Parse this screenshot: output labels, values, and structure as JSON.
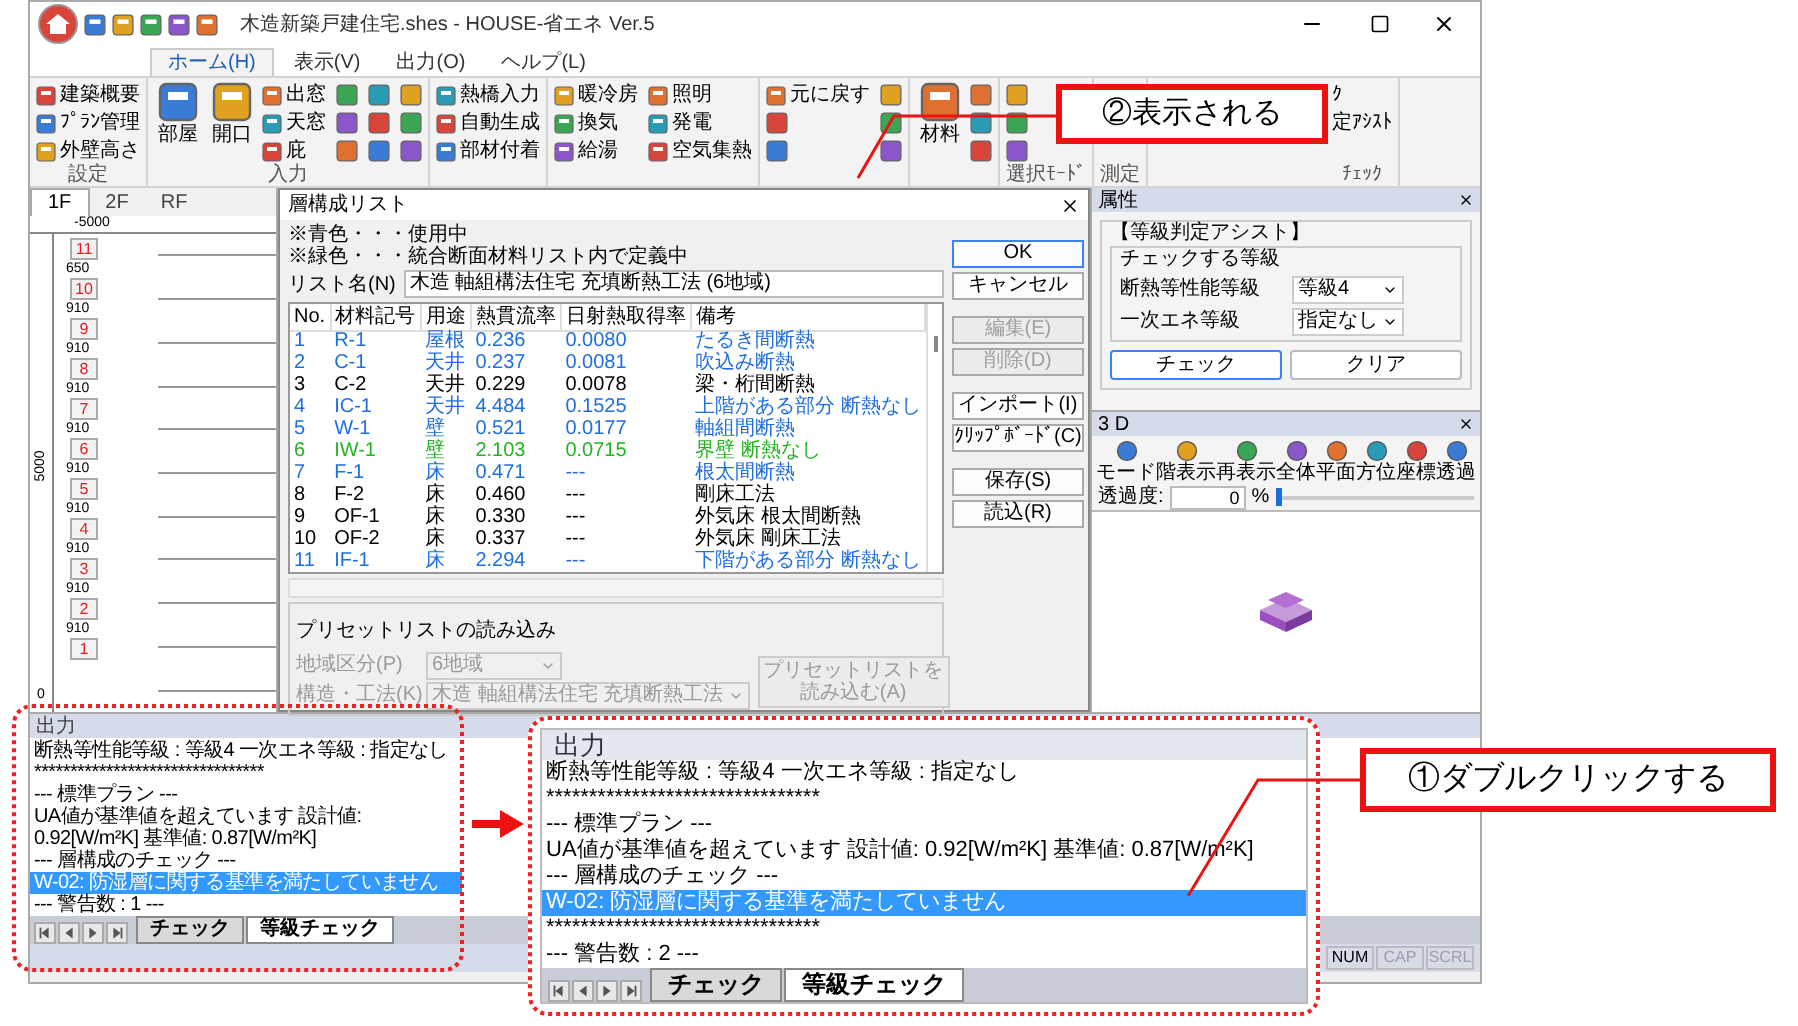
{
  "window": {
    "title": "木造新築戸建住宅.shes - HOUSE-省エネ Ver.5"
  },
  "menu_tabs": [
    {
      "label": "ホーム(H)",
      "selected": true
    },
    {
      "label": "表示(V)",
      "selected": false
    },
    {
      "label": "出力(O)",
      "selected": false
    },
    {
      "label": "ヘルプ(L)",
      "selected": false
    }
  ],
  "ribbon": [
    {
      "label": "設定",
      "items": [
        {
          "kind": "small",
          "label": "建築概要"
        },
        {
          "kind": "small",
          "label": "ﾌﾟﾗﾝ管理"
        },
        {
          "kind": "small",
          "label": "外壁高さ"
        }
      ]
    },
    {
      "label": "入力",
      "items": [
        {
          "kind": "large",
          "label": "部屋"
        },
        {
          "kind": "large",
          "label": "開口"
        },
        {
          "kind": "small",
          "label": "出窓"
        },
        {
          "kind": "small",
          "label": "天窓"
        },
        {
          "kind": "small",
          "label": "庇"
        },
        {
          "kind": "icon"
        },
        {
          "kind": "icon"
        },
        {
          "kind": "icon"
        },
        {
          "kind": "icon"
        },
        {
          "kind": "icon"
        },
        {
          "kind": "icon"
        },
        {
          "kind": "icon"
        },
        {
          "kind": "icon"
        },
        {
          "kind": "icon"
        }
      ]
    },
    {
      "items": [
        {
          "kind": "small",
          "label": "熱橋入力"
        },
        {
          "kind": "small",
          "label": "自動生成"
        },
        {
          "kind": "small",
          "label": "部材付着"
        }
      ]
    },
    {
      "items": [
        {
          "kind": "small",
          "label": "暖冷房"
        },
        {
          "kind": "small",
          "label": "換気"
        },
        {
          "kind": "small",
          "label": "給湯"
        },
        {
          "kind": "small",
          "label": "照明"
        },
        {
          "kind": "small",
          "label": "発電"
        },
        {
          "kind": "small",
          "label": "空気集熱"
        }
      ]
    },
    {
      "items": [
        {
          "kind": "small",
          "label": "元に戻す"
        },
        {
          "kind": "icon"
        },
        {
          "kind": "icon"
        },
        {
          "kind": "icon"
        },
        {
          "kind": "icon"
        },
        {
          "kind": "icon"
        }
      ]
    },
    {
      "items": [
        {
          "kind": "large",
          "label": "材料"
        },
        {
          "kind": "icon"
        },
        {
          "kind": "icon"
        },
        {
          "kind": "icon"
        }
      ]
    },
    {
      "label": "選択ﾓｰﾄﾞ",
      "items": [
        {
          "kind": "icon"
        },
        {
          "kind": "icon"
        },
        {
          "kind": "icon"
        }
      ]
    },
    {
      "label": "測定",
      "items": [
        {
          "kind": "icon"
        }
      ]
    },
    {
      "label": "ﾁｪｯｸ",
      "items": [
        {
          "kind": "text",
          "label": "ｸ"
        },
        {
          "kind": "text",
          "label": "定ｱｼｽﾄ"
        }
      ]
    }
  ],
  "floor_tabs": [
    {
      "label": "1F",
      "selected": true
    },
    {
      "label": "2F",
      "selected": false
    },
    {
      "label": "RF",
      "selected": false
    }
  ],
  "plan": {
    "x_ruler": "-5000",
    "y_ruler": "5000",
    "origin": "0",
    "rooms": [
      {
        "number": "11",
        "dimension": "650"
      },
      {
        "number": "10",
        "dimension": "910"
      },
      {
        "number": "9",
        "dimension": "910"
      },
      {
        "number": "8",
        "dimension": "910"
      },
      {
        "number": "7",
        "dimension": "910"
      },
      {
        "number": "6",
        "dimension": "910"
      },
      {
        "number": "5",
        "dimension": "910"
      },
      {
        "number": "4",
        "dimension": "910"
      },
      {
        "number": "3",
        "dimension": "910"
      },
      {
        "number": "2",
        "dimension": "910"
      },
      {
        "number": "1"
      }
    ]
  },
  "dialog": {
    "title": "層構成リスト",
    "notes": [
      "※青色・・・使用中",
      "※緑色・・・統合断面材料リスト内で定義中"
    ],
    "list_name_label": "リスト名(N)",
    "list_name": "木造 軸組構法住宅 充填断熱工法 (6地域)",
    "columns": [
      "No.",
      "材料記号",
      "用途",
      "熱貫流率",
      "日射熱取得率",
      "備考"
    ],
    "rows": [
      {
        "cells": [
          "1",
          "R-1",
          "屋根",
          "0.236",
          "0.0080",
          "たるき間断熱"
        ],
        "color": "#1f6fe0"
      },
      {
        "cells": [
          "2",
          "C-1",
          "天井",
          "0.237",
          "0.0081",
          "吹込み断熱"
        ],
        "color": "#1f6fe0"
      },
      {
        "cells": [
          "3",
          "C-2",
          "天井",
          "0.229",
          "0.0078",
          "梁・桁間断熱"
        ],
        "color": "#000000"
      },
      {
        "cells": [
          "4",
          "IC-1",
          "天井",
          "4.484",
          "0.1525",
          "上階がある部分 断熱なし"
        ],
        "color": "#1f6fe0"
      },
      {
        "cells": [
          "5",
          "W-1",
          "壁",
          "0.521",
          "0.0177",
          "軸組間断熱"
        ],
        "color": "#1f6fe0"
      },
      {
        "cells": [
          "6",
          "IW-1",
          "壁",
          "2.103",
          "0.0715",
          "界壁 断熱なし"
        ],
        "color": "#22b422"
      },
      {
        "cells": [
          "7",
          "F-1",
          "床",
          "0.471",
          "---",
          "根太間断熱"
        ],
        "color": "#1f6fe0"
      },
      {
        "cells": [
          "8",
          "F-2",
          "床",
          "0.460",
          "---",
          "剛床工法"
        ],
        "color": "#000000"
      },
      {
        "cells": [
          "9",
          "OF-1",
          "床",
          "0.330",
          "---",
          "外気床 根太間断熱"
        ],
        "color": "#000000"
      },
      {
        "cells": [
          "10",
          "OF-2",
          "床",
          "0.337",
          "---",
          "外気床 剛床工法"
        ],
        "color": "#000000"
      },
      {
        "cells": [
          "11",
          "IF-1",
          "床",
          "2.294",
          "---",
          "下階がある部分 断熱なし"
        ],
        "color": "#1f6fe0"
      }
    ],
    "buttons": [
      {
        "label": "OK",
        "disabled": false,
        "focused": true
      },
      {
        "label": "キャンセル",
        "disabled": false,
        "focused": false
      },
      {
        "label": "編集(E)",
        "disabled": true,
        "focused": false
      },
      {
        "label": "削除(D)",
        "disabled": true,
        "focused": false
      },
      {
        "label": "インポート(I)",
        "disabled": false,
        "focused": false
      },
      {
        "label": "ｸﾘｯﾌﾟﾎﾞｰﾄﾞ(C)",
        "disabled": false,
        "focused": false
      },
      {
        "label": "保存(S)",
        "disabled": false,
        "focused": false
      },
      {
        "label": "読込(R)",
        "disabled": false,
        "focused": false
      }
    ],
    "preset": {
      "title": "プリセットリストの読み込み",
      "disabled": true,
      "region_label": "地域区分(P)",
      "region": "6地域",
      "structure_label": "構造・工法(K)",
      "structure": "木造 軸組構法住宅 充填断熱工法",
      "button": "プリセットリストを読み込む(A)"
    }
  },
  "properties_panel": {
    "title": "属性",
    "group": "【等級判定アシスト】",
    "subgroup": "チェックする等級",
    "fields": [
      {
        "label": "断熱等性能等級",
        "value": "等級4"
      },
      {
        "label": "一次エネ等級",
        "value": "指定なし"
      }
    ],
    "buttons": [
      {
        "label": "チェック",
        "focused": true
      },
      {
        "label": "クリア",
        "focused": false
      }
    ]
  },
  "view3d": {
    "title": "3 D",
    "tools": [
      "モード",
      "階表示",
      "再表示",
      "全体",
      "平面",
      "方位",
      "座標",
      "透過"
    ],
    "transparency_label": "透過度:",
    "transparency": "0",
    "unit": "%",
    "level": 0
  },
  "output_panel": {
    "title": "出力",
    "lines": [
      {
        "text": "断熱等性能等級 : 等級4  一次エネ等級 : 指定なし",
        "selected": false
      },
      {
        "text": "********************************",
        "selected": false
      },
      {
        "text": "--- 標準プラン ---",
        "selected": false
      },
      {
        "text": "UA値が基準値を超えています  設計値: 0.92[W/m²K]  基準値: 0.87[W/m²K]",
        "selected": false
      },
      {
        "text": "--- 層構成のチェック ---",
        "selected": false
      },
      {
        "text": "W-02: 防湿層に関する基準を満たしていません",
        "selected": true
      },
      {
        "text": "--- 警告数 : 1 ---",
        "selected": false
      }
    ],
    "tabs": [
      {
        "label": "チェック",
        "selected": false
      },
      {
        "label": "等級チェック",
        "selected": true
      }
    ]
  },
  "status_bar": [
    {
      "label": "NUM",
      "on": true
    },
    {
      "label": "CAP",
      "on": false
    },
    {
      "label": "SCRL",
      "on": false
    }
  ],
  "magnified_output": {
    "title": "出力",
    "lines": [
      {
        "text": "断熱等性能等級 : 等級4  一次エネ等級 : 指定なし",
        "selected": false
      },
      {
        "text": "********************************",
        "selected": false
      },
      {
        "text": "--- 標準プラン ---",
        "selected": false
      },
      {
        "text": "UA値が基準値を超えています  設計値: 0.92[W/m²K]  基準値: 0.87[W/m²K]",
        "selected": false
      },
      {
        "text": "--- 層構成のチェック ---",
        "selected": false
      },
      {
        "text": "W-02: 防湿層に関する基準を満たしていません",
        "selected": true
      },
      {
        "text": "********************************",
        "selected": false
      },
      {
        "text": "--- 警告数 : 2 ---",
        "selected": false
      }
    ],
    "tabs": [
      {
        "label": "チェック",
        "selected": false
      },
      {
        "label": "等級チェック",
        "selected": true
      }
    ]
  },
  "callouts": [
    "②表示される",
    "①ダブルクリックする"
  ]
}
